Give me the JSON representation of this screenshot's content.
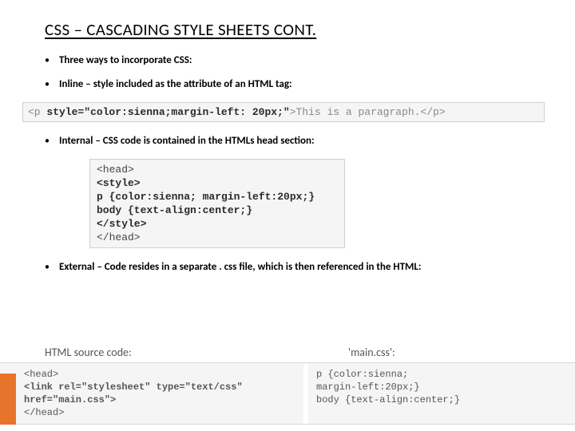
{
  "title": "CSS – CASCADING STYLE SHEETS CONT.",
  "bullets": {
    "intro": "Three ways to incorporate CSS:",
    "inline_label": "Inline",
    "inline_rest": " – style included as the attribute of an HTML tag:",
    "internal_label": "Internal",
    "internal_rest": " – CSS code is contained in the HTMLs head section:",
    "external_label": "External",
    "external_rest": " – Code resides in a separate . css file, which is then referenced in the HTML:"
  },
  "code": {
    "inline_open": "<p ",
    "inline_attr": "style=\"color:sienna;margin-left: 20px;\"",
    "inline_close": ">This is a paragraph.</p>",
    "internal_l1": "<head>",
    "internal_l2": "<style>",
    "internal_l3": "p {color:sienna; margin-left:20px;}",
    "internal_l4": "body {text-align:center;}",
    "internal_l5": "</style>",
    "internal_l6": "</head>",
    "ext_label_left": "HTML source code:",
    "ext_label_right": "'main.css':",
    "ext_left_l1": "<head>",
    "ext_left_l2": "<link rel=\"stylesheet\" type=\"text/css\"",
    "ext_left_l3": "href=\"main.css\">",
    "ext_left_l4": "</head>",
    "ext_right_l1": "p {color:sienna;",
    "ext_right_l2": "margin-left:20px;}",
    "ext_right_l3": "body {text-align:center;}"
  }
}
